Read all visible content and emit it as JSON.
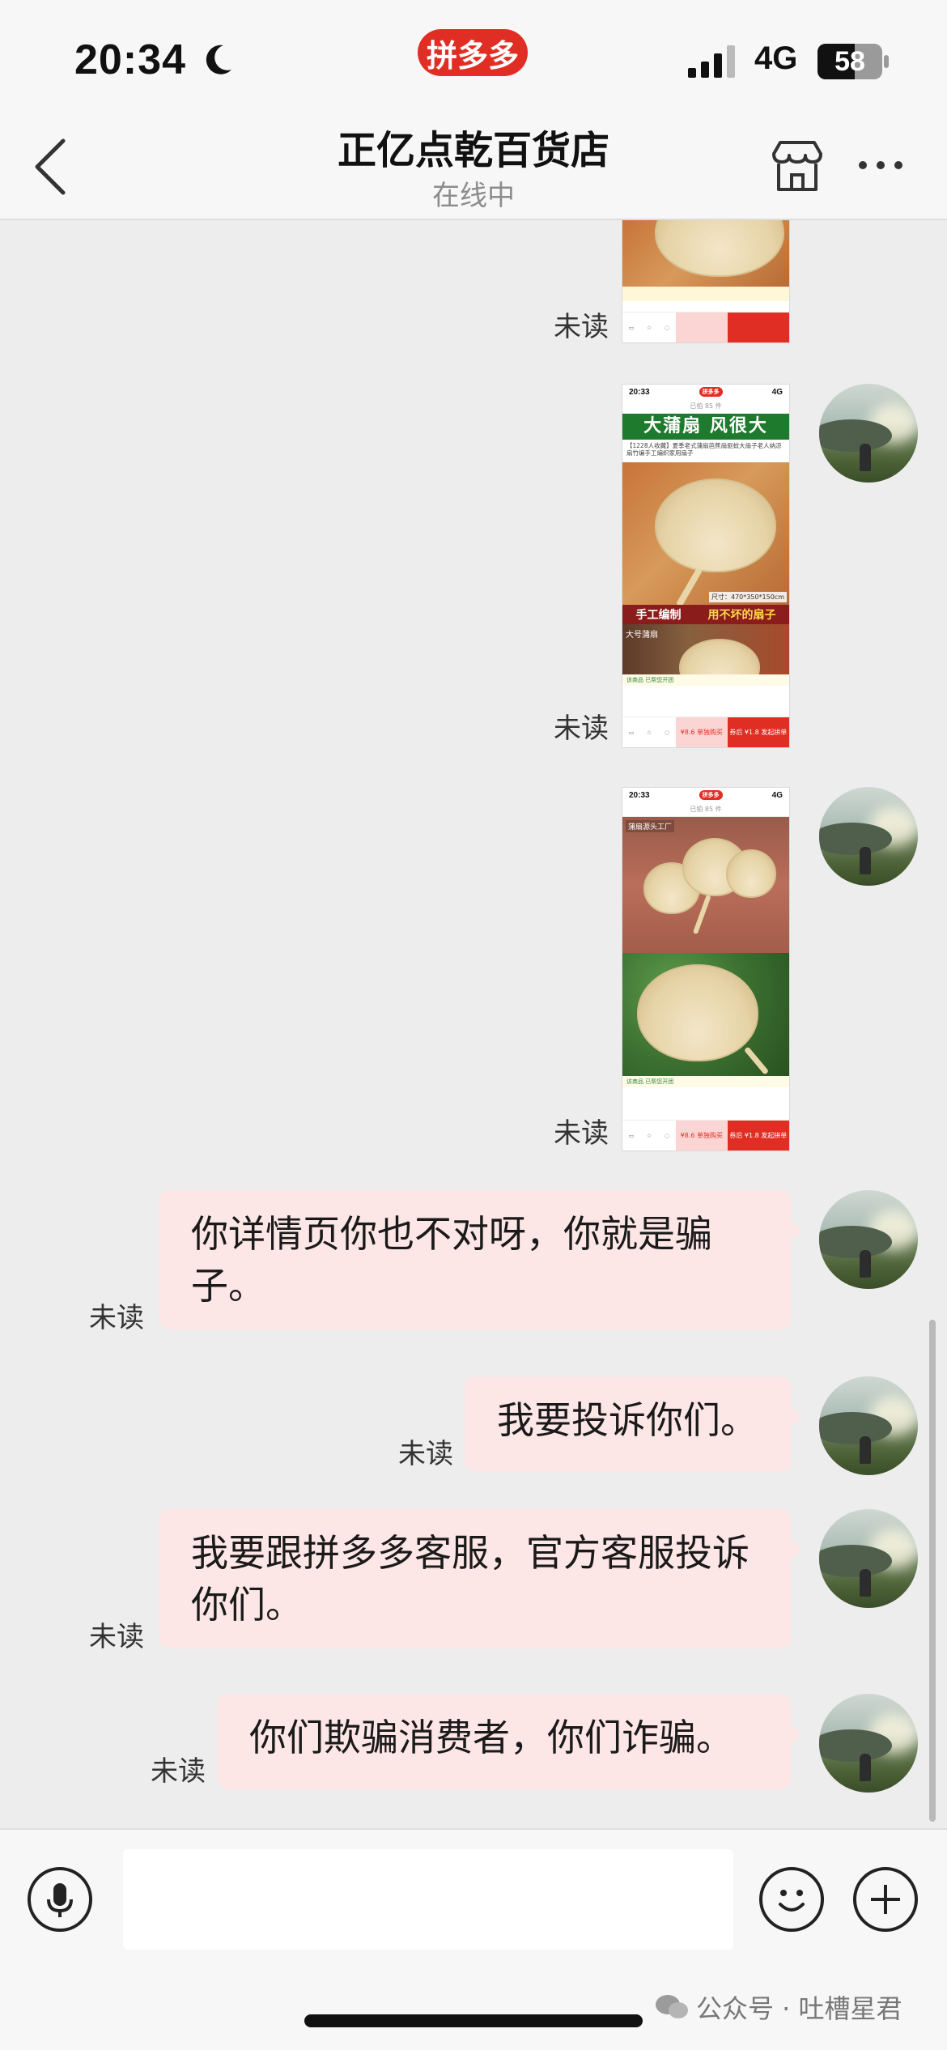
{
  "status_bar": {
    "time": "20:34",
    "network": "4G",
    "battery_level": "58",
    "battery_fraction": 0.58,
    "brand_badge": "拼多多"
  },
  "header": {
    "title": "正亿点乾百货店",
    "subtitle": "在线中"
  },
  "messages": {
    "unread_label": "未读",
    "shot2": {
      "time": "20:33",
      "nav": "已拍 85 件",
      "banner": "大蒲扇 风很大",
      "desc": "【1228人收藏】夏季老式蒲扇芭蕉扇驱蚊大扇子老人纳凉扇竹编手工编织家用扇子",
      "dims": "尺寸：470*350*150cm",
      "redbar_left": "手工编制",
      "redbar_right": "用不坏的扇子",
      "dark_label": "大号蒲扇",
      "notice": "该商品 已帮您开团",
      "foot_b1": "¥8.6 单独购买",
      "foot_b2": "券后 ¥1.8 发起拼单"
    },
    "shot3": {
      "time": "20:33",
      "nav": "已拍 85 件",
      "photo_label": "蒲扇源头工厂",
      "notice": "该商品 已帮您开团",
      "foot_b1": "¥8.6 单独购买",
      "foot_b2": "券后 ¥1.8 发起拼单"
    },
    "text1": "你详情页你也不对呀，你就是骗子。",
    "text2": "我要投诉你们。",
    "text3": "我要跟拼多多客服，官方客服投诉你们。",
    "text4": "你们欺骗消费者，你们诈骗。"
  },
  "input": {
    "placeholder": ""
  },
  "watermark": {
    "text": "公众号 · 吐槽星君"
  },
  "colors": {
    "accent": "#e02e24",
    "bubble": "#fde6e6",
    "background": "#ededed"
  }
}
